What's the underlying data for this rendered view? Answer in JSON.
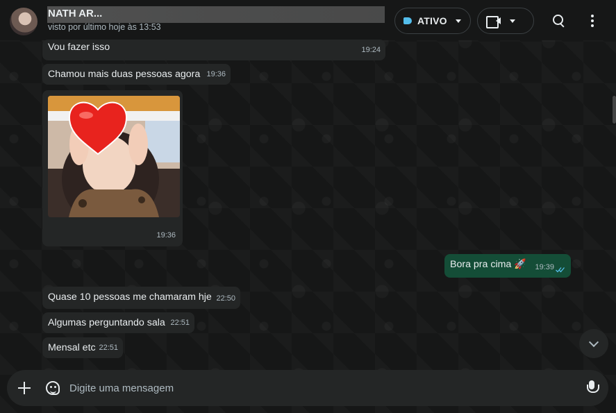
{
  "header": {
    "contact_name": "NATH                                   AR...",
    "last_seen": "visto por último hoje às 13:53",
    "label_pill": "ATIVO"
  },
  "messages": [
    {
      "text": "Vou fazer isso",
      "time": "19:24",
      "direction": "in"
    },
    {
      "text": "Chamou mais duas pessoas agora",
      "time": "19:36",
      "direction": "in"
    },
    {
      "type": "image",
      "time": "19:36",
      "direction": "in"
    },
    {
      "text": "Bora pra cima 🚀",
      "time": "19:39",
      "direction": "out",
      "status": "read"
    },
    {
      "text": "Quase 10 pessoas me chamaram hje",
      "time": "22:50",
      "direction": "in"
    },
    {
      "text": "Algumas perguntando sala",
      "time": "22:51",
      "direction": "in"
    },
    {
      "text": "Mensal etc",
      "time": "22:51",
      "direction": "in"
    }
  ],
  "composer": {
    "placeholder": "Digite uma mensagem"
  },
  "icons": {
    "label": "label-icon",
    "video": "video-call-icon",
    "search": "search-icon",
    "menu": "more-options-icon",
    "attach": "plus-icon",
    "sticker": "sticker-icon",
    "mic": "microphone-icon",
    "scroll": "chevron-down-icon"
  },
  "colors": {
    "background": "#161717",
    "incoming_bubble": "#242626",
    "outgoing_bubble": "#144d37",
    "read_ticks": "#53bdeb",
    "label": "#53bdeb"
  }
}
